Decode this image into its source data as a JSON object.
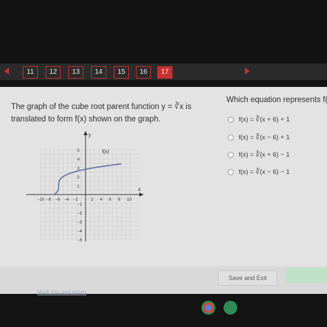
{
  "navigation": {
    "tabs": [
      "11",
      "12",
      "13",
      "14",
      "15",
      "16",
      "17"
    ],
    "active": "17"
  },
  "question": {
    "line1": "The graph of the cube root parent function y = ∛x is",
    "line2": "translated to form f(x) shown on the graph."
  },
  "prompt": "Which equation represents f(x)?",
  "options": [
    "f(x) = ∛(x + 6) + 1",
    "f(x) = ∛(x − 6) + 1",
    "f(x) = ∛(x + 6) − 1",
    "f(x) = ∛(x − 6) − 1"
  ],
  "graph": {
    "function_label": "f(x)",
    "x_label": "x",
    "y_label": "y",
    "x_ticks": [
      "−10",
      "−8",
      "−6",
      "−4",
      "−2",
      "2",
      "4",
      "6",
      "8",
      "10"
    ],
    "y_ticks": [
      "5",
      "4",
      "3",
      "2",
      "1",
      "−1",
      "−2",
      "−3",
      "−4",
      "−5"
    ],
    "curve_color": "#5a6ea6"
  },
  "footer": {
    "save_exit": "Save and Exit",
    "link": "Mark this and return"
  }
}
